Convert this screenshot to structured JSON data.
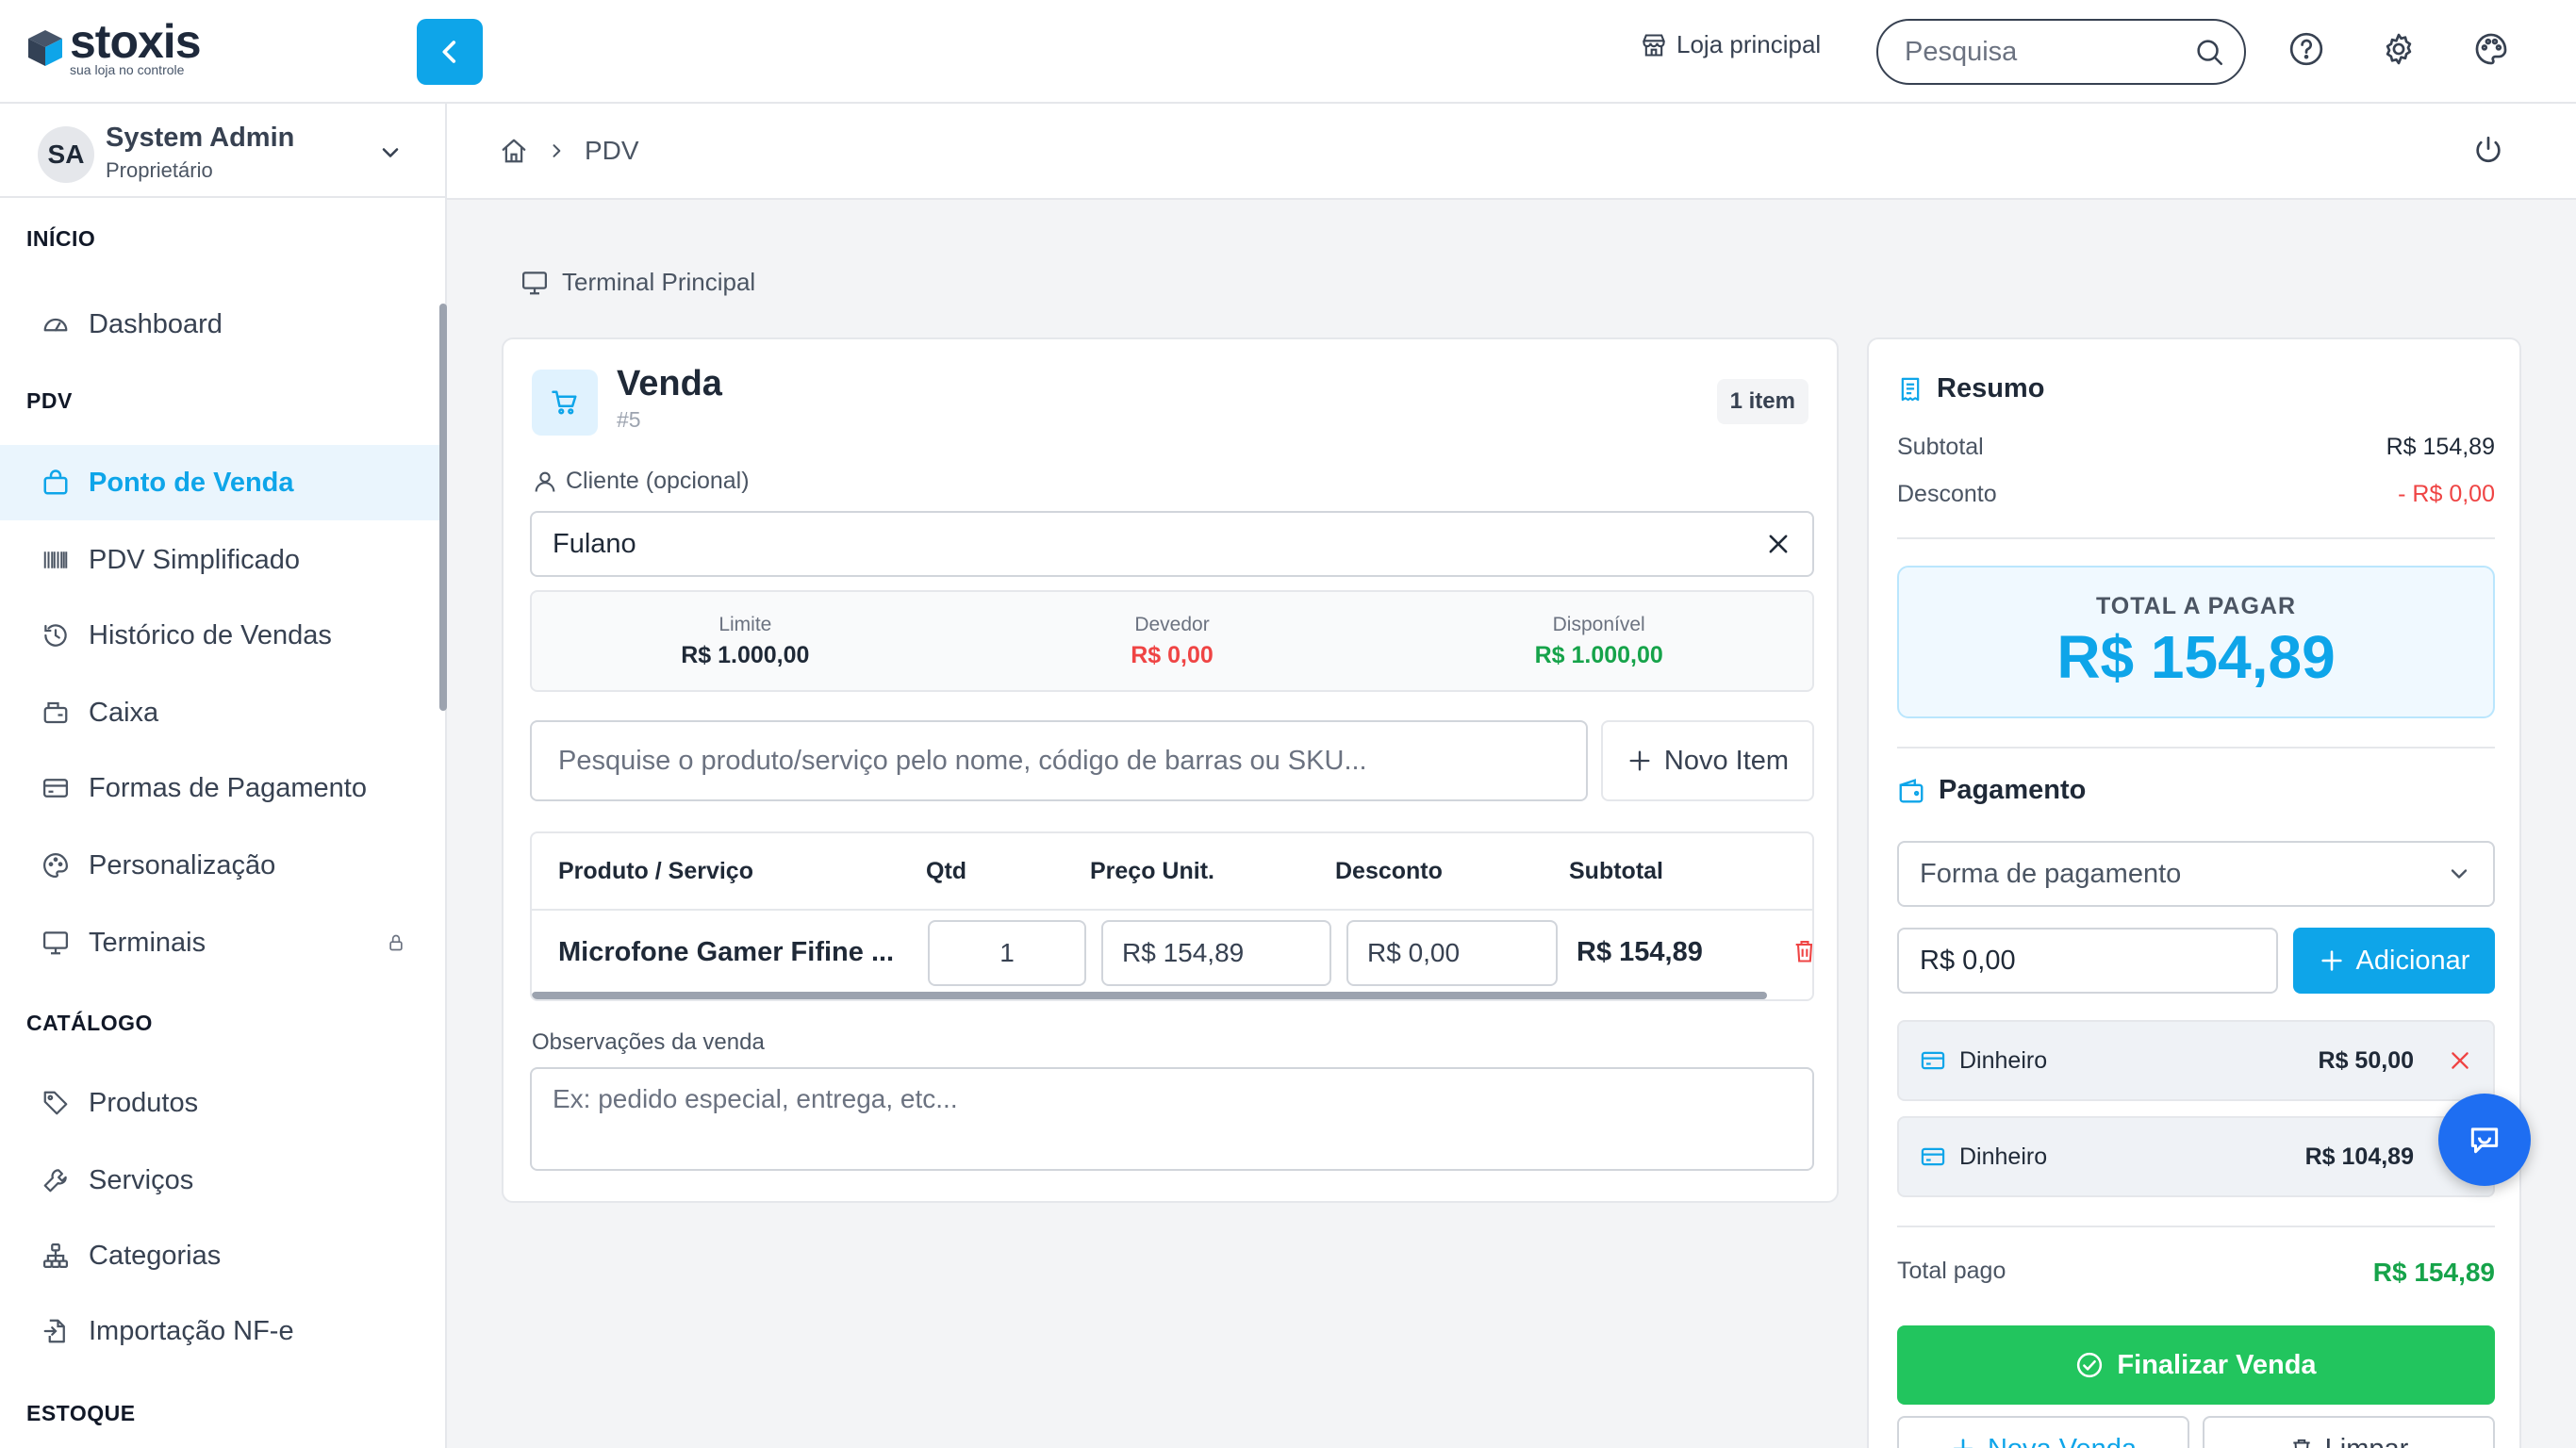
{
  "brand": {
    "name": "stoxis",
    "tagline": "sua loja no controle"
  },
  "header": {
    "store_label": "Loja principal",
    "search_placeholder": "Pesquisa"
  },
  "user": {
    "initials": "SA",
    "name": "System Admin",
    "role": "Proprietário"
  },
  "sidebar": {
    "sections": {
      "inicio": "INÍCIO",
      "pdv": "PDV",
      "catalogo": "CATÁLOGO",
      "estoque": "ESTOQUE"
    },
    "items": {
      "dashboard": "Dashboard",
      "ponto_de_venda": "Ponto de Venda",
      "pdv_simplificado": "PDV Simplificado",
      "historico": "Histórico de Vendas",
      "caixa": "Caixa",
      "formas_pagamento": "Formas de Pagamento",
      "personalizacao": "Personalização",
      "terminais": "Terminais",
      "produtos": "Produtos",
      "servicos": "Serviços",
      "categorias": "Categorias",
      "importacao": "Importação NF-e"
    }
  },
  "breadcrumb": {
    "current": "PDV"
  },
  "terminal": "Terminal Principal",
  "sale": {
    "title": "Venda",
    "number": "#5",
    "item_count": "1 item",
    "client_label": "Cliente (opcional)",
    "client_value": "Fulano",
    "credit": {
      "limit_label": "Limite",
      "limit_value": "R$ 1.000,00",
      "debt_label": "Devedor",
      "debt_value": "R$ 0,00",
      "available_label": "Disponível",
      "available_value": "R$ 1.000,00"
    },
    "product_search_placeholder": "Pesquise o produto/serviço pelo nome, código de barras ou SKU...",
    "new_item_label": "Novo Item",
    "table": {
      "headers": {
        "product": "Produto / Serviço",
        "qty": "Qtd",
        "unit_price": "Preço Unit.",
        "discount": "Desconto",
        "subtotal": "Subtotal"
      },
      "rows": [
        {
          "product": "Microfone Gamer Fifine ...",
          "qty": "1",
          "unit_price": "R$ 154,89",
          "discount": "R$ 0,00",
          "subtotal": "R$ 154,89"
        }
      ]
    },
    "notes_label": "Observações da venda",
    "notes_placeholder": "Ex: pedido especial, entrega, etc..."
  },
  "summary": {
    "title": "Resumo",
    "subtotal_label": "Subtotal",
    "subtotal_value": "R$ 154,89",
    "discount_label": "Desconto",
    "discount_value": "- R$ 0,00",
    "total_label": "TOTAL A PAGAR",
    "total_value": "R$ 154,89",
    "payment_title": "Pagamento",
    "payment_method_placeholder": "Forma de pagamento",
    "amount_value": "R$ 0,00",
    "add_label": "Adicionar",
    "payments": [
      {
        "method": "Dinheiro",
        "amount": "R$ 50,00"
      },
      {
        "method": "Dinheiro",
        "amount": "R$ 104,89"
      }
    ],
    "total_paid_label": "Total pago",
    "total_paid_value": "R$ 154,89",
    "finalize_label": "Finalizar Venda",
    "new_sale_label": "Nova Venda",
    "clear_label": "Limpar"
  },
  "colors": {
    "accent": "#0ea5e9",
    "success": "#22c55e",
    "danger": "#ef4444",
    "fab": "#1e6ef2"
  },
  "icons": [
    "cube-logo-icon",
    "chevron-left-icon",
    "store-icon",
    "search-icon",
    "help-icon",
    "gear-icon",
    "palette-icon",
    "home-icon",
    "power-icon",
    "monitor-icon",
    "cart-icon",
    "user-icon",
    "close-icon",
    "plus-icon",
    "trash-icon",
    "receipt-icon",
    "wallet-icon",
    "card-icon",
    "check-circle-icon",
    "chat-icon"
  ]
}
